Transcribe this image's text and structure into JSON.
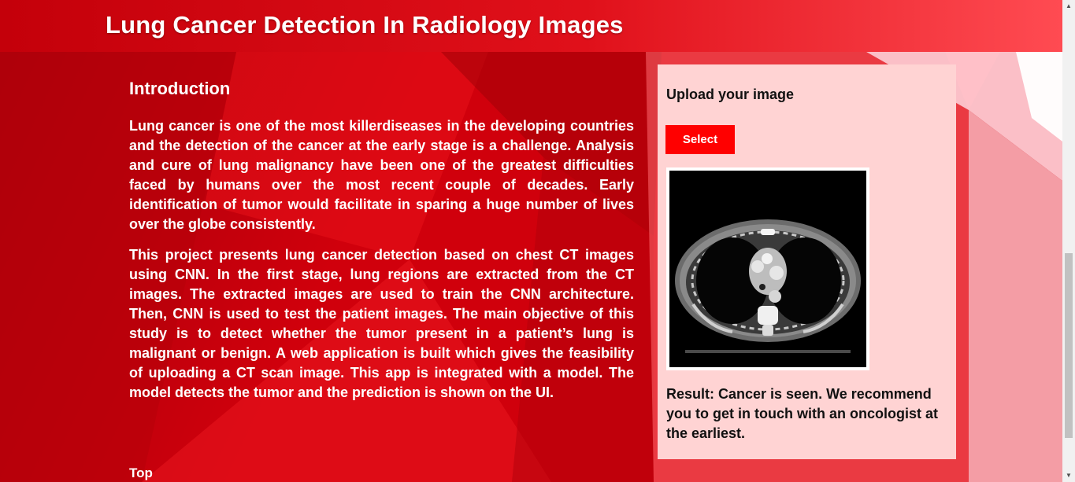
{
  "header": {
    "title": "Lung Cancer Detection In Radiology Images"
  },
  "intro": {
    "heading": "Introduction",
    "paragraphs": [
      "Lung cancer is one of the most killerdiseases in the developing countries and the detection of the cancer at the early stage is a challenge. Analysis and cure of lung malignancy have been one of the greatest difficulties faced by humans over the most recent couple of decades. Early identification of tumor would facilitate in sparing a huge number of lives over the globe consistently.",
      "This project presents lung cancer detection based on chest CT images using CNN. In the first stage, lung regions are extracted from the CT images. The extracted images are used to train the CNN architecture. Then, CNN is used to test the patient images. The main objective of this study is to detect whether the tumor present in a patient’s lung is malignant or benign. A web application is built which gives the feasibility of uploading a CT scan image. This app is integrated with a model. The model detects the tumor and the prediction is shown on the UI."
    ],
    "top_link": "Top"
  },
  "upload_panel": {
    "title": "Upload your image",
    "select_label": "Select",
    "result_text": "Result: Cancer is seen. We recommend you to get in touch with an oncologist at the earliest."
  },
  "colors": {
    "header_bg": "#e0101a",
    "panel_bg": "#ffd3d3",
    "select_button": "#ff0000",
    "background_red": "#d0000c"
  },
  "icons": {
    "scroll_up": "triangle-up-icon",
    "scroll_down": "triangle-down-icon"
  }
}
